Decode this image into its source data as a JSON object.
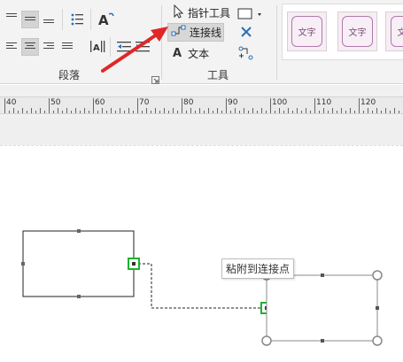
{
  "ribbon": {
    "paragraph_group": {
      "label": "段落"
    },
    "tools_group": {
      "label": "工具",
      "pointer_label": "指针工具",
      "connector_label": "连接线",
      "text_label": "文本"
    },
    "styles": [
      {
        "label": "文字"
      },
      {
        "label": "文字"
      },
      {
        "label": "文字"
      }
    ]
  },
  "ruler": {
    "labels": [
      "40",
      "50",
      "60",
      "70",
      "80",
      "90",
      "100",
      "110",
      "120"
    ]
  },
  "canvas": {
    "tooltip_text": "粘附到连接点"
  },
  "colors": {
    "accent_green": "#1fb32f",
    "arrow_red": "#e02727",
    "style_border": "#b07aa8"
  }
}
